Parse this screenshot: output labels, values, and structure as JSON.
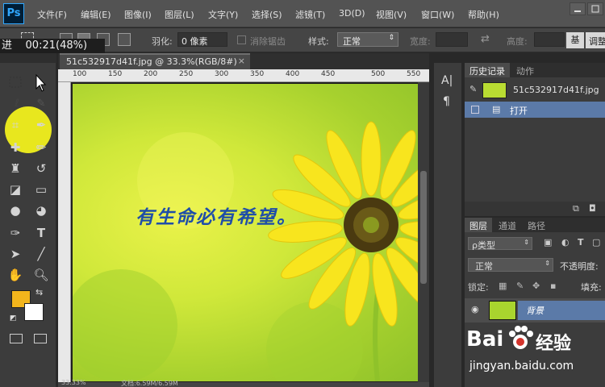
{
  "menu": {
    "logo": "Ps",
    "items": [
      "文件(F)",
      "编辑(E)",
      "图像(I)",
      "图层(L)",
      "文字(Y)",
      "选择(S)",
      "滤镜(T)",
      "3D(D)",
      "视图(V)",
      "窗口(W)",
      "帮助(H)"
    ]
  },
  "overlay": {
    "progress_text": "进    00:21(48%)"
  },
  "options": {
    "feather_label": "羽化:",
    "feather_value": "0 像素",
    "antialias_label": "消除锯齿",
    "style_label": "样式:",
    "style_value": "正常",
    "width_label": "宽度:",
    "height_label": "高度:",
    "partial_button": "基",
    "adjust_label": "调整"
  },
  "document": {
    "tab_title": "51c532917d41f.jpg @ 33.3%(RGB/8#)",
    "close_glyph": "×",
    "ruler_ticks": [
      "100",
      "150",
      "200",
      "250",
      "300",
      "350",
      "400",
      "450",
      "500",
      "550"
    ],
    "image_text": "有生命必有希望。",
    "zoom_status": "33.33%",
    "doc_status": "文档:6.59M/6.59M"
  },
  "history": {
    "tab_active": "历史记录",
    "tab_other": "动作",
    "snapshot_name": "51c532917d41f.jpg",
    "steps": [
      "打开"
    ]
  },
  "layers": {
    "tabs": [
      "图层",
      "通道",
      "路径"
    ],
    "kind_filter": "ρ类型",
    "blend_mode": "正常",
    "opacity_label": "不透明度:",
    "lock_label": "锁定:",
    "fill_label": "填充:",
    "layer_name": "背景"
  },
  "watermark": {
    "brand": "Bai",
    "brand2": "经验",
    "url": "jingyan.baidu.com"
  },
  "colors": {
    "foreground": "#f2b51c",
    "background": "#ffffff",
    "highlight": "#f1f01c",
    "text_blue": "#1f4ea8"
  }
}
